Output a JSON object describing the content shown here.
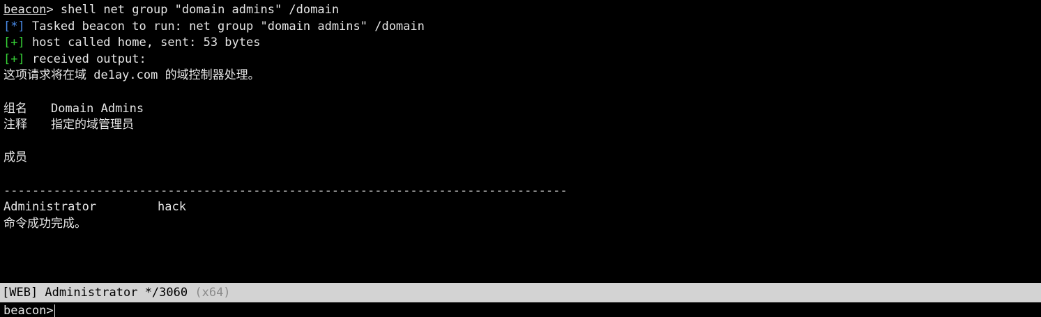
{
  "console": {
    "prompt_name": "beacon",
    "prompt_suffix": "> ",
    "command": "shell net group \"domain admins\" /domain",
    "tasked_tag": "[*]",
    "tasked_text": " Tasked beacon to run: net group \"domain admins\" /domain",
    "called_tag": "[+]",
    "called_text": " host called home, sent: 53 bytes",
    "received_tag": "[+]",
    "received_text": " received output:",
    "output": {
      "intro": "这项请求将在域 de1ay.com 的域控制器处理。",
      "group_name_label": "组名",
      "group_name_value": "Domain Admins",
      "comment_label": "注释",
      "comment_value": "指定的域管理员",
      "members_label": "成员",
      "separator": "-------------------------------------------------------------------------------",
      "members": [
        "Administrator",
        "hack"
      ],
      "success": "命令成功完成。"
    }
  },
  "status_bar": {
    "text": "[WEB] Administrator */3060",
    "arch": "(x64)"
  },
  "input": {
    "prompt": "beacon>",
    "value": ""
  },
  "colors": {
    "background": "#000000",
    "text": "#e6e6e6",
    "tag_star": "#4a8be8",
    "tag_plus": "#37d437",
    "status_bg": "#d3d3d3"
  }
}
